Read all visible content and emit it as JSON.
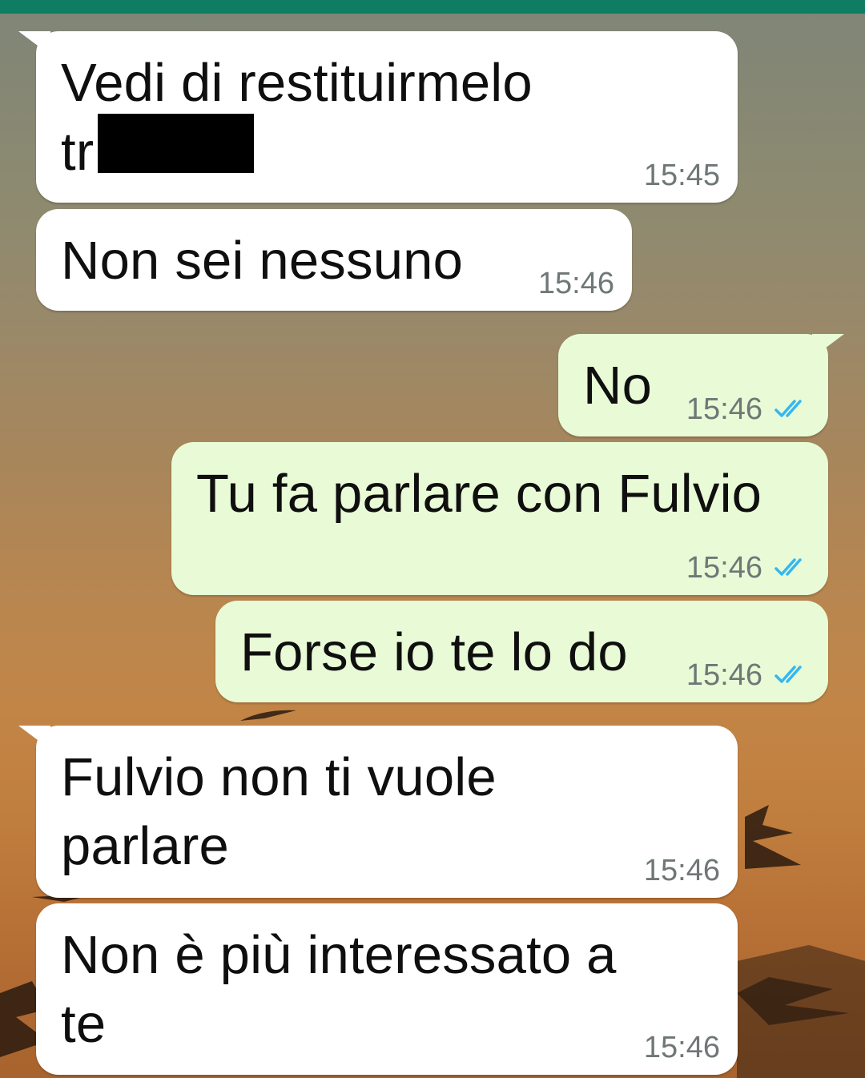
{
  "colors": {
    "header": "#0e7d62",
    "incoming_bubble": "#ffffff",
    "outgoing_bubble": "#e8fbd6",
    "timestamp": "#6f7777",
    "read_ticks": "#34b7f1"
  },
  "messages": [
    {
      "direction": "incoming",
      "text": "Vedi di restituirmelo\ntr",
      "time": "15:45",
      "redacted": true
    },
    {
      "direction": "incoming",
      "text": "Non sei nessuno",
      "time": "15:46"
    },
    {
      "direction": "outgoing",
      "text": "No",
      "time": "15:46",
      "status_icon": "double-check-icon"
    },
    {
      "direction": "outgoing",
      "text": "Tu fa parlare con Fulvio",
      "time": "15:46",
      "status_icon": "double-check-icon"
    },
    {
      "direction": "outgoing",
      "text": "Forse io te lo do",
      "time": "15:46",
      "status_icon": "double-check-icon"
    },
    {
      "direction": "incoming",
      "text": "Fulvio non ti vuole\nparlare",
      "time": "15:46"
    },
    {
      "direction": "incoming",
      "text": "Non è più interessato a\nte",
      "time": "15:46"
    }
  ]
}
